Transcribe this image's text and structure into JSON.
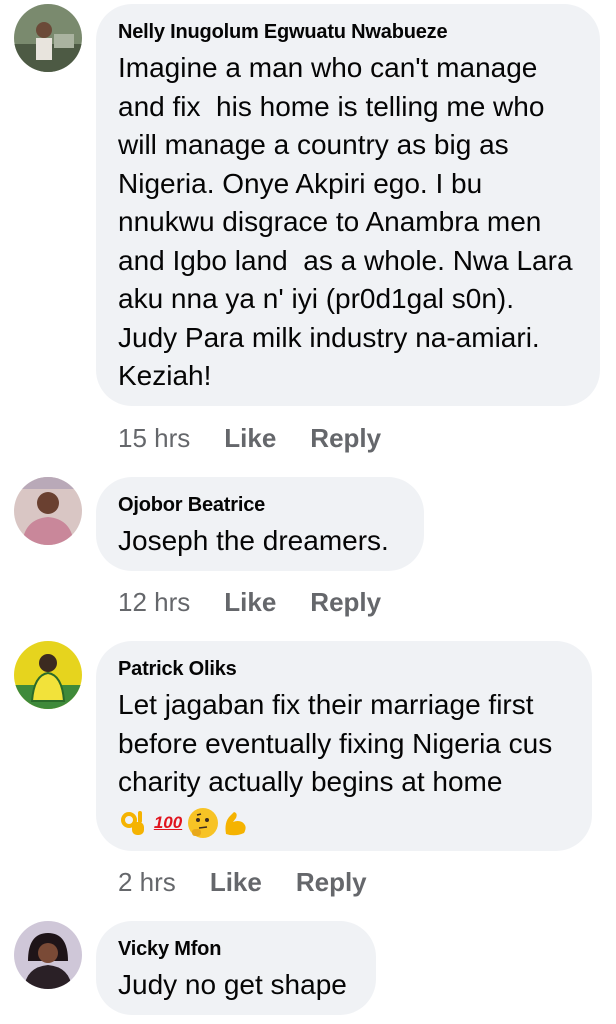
{
  "comments": [
    {
      "author": "Nelly Inugolum Egwuatu Nwabueze",
      "text": "Imagine a man who can't manage\nand fix  his home is telling me who\nwill manage a country as big as\nNigeria. Onye Akpiri ego. I bu\nnnukwu disgrace to Anambra men\nand Igbo land  as a whole. Nwa Lara\naku nna ya n' iyi (pr0d1gal s0n).\nJudy Para milk industry na-amiari.\nKeziah!",
      "time": "15 hrs",
      "like": "Like",
      "reply": "Reply"
    },
    {
      "author": "Ojobor Beatrice",
      "text": "Joseph the dreamers.",
      "time": "12 hrs",
      "like": "Like",
      "reply": "Reply"
    },
    {
      "author": "Patrick Oliks",
      "text": "Let jagaban fix their marriage first\nbefore eventually fixing Nigeria cus\ncharity actually begins at home",
      "reactions": [
        "ok-hand-emoji",
        "hundred-points-emoji",
        "thinking-face-emoji",
        "flexed-biceps-emoji"
      ],
      "hundred_label": "100",
      "time": "2 hrs",
      "like": "Like",
      "reply": "Reply"
    },
    {
      "author": "Vicky Mfon",
      "text": "Judy no get shape"
    }
  ]
}
